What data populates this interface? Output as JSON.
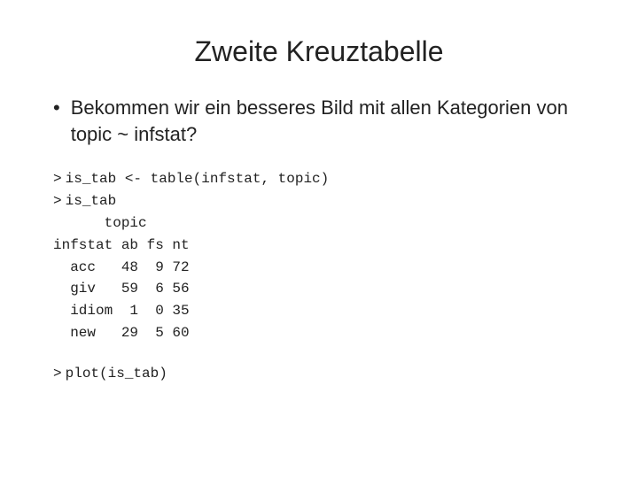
{
  "title": "Zweite Kreuztabelle",
  "bullet": {
    "text": "Bekommen wir ein besseres Bild mit allen Kategorien von topic ~ infstat?"
  },
  "code": {
    "line1_prompt": ">",
    "line1_code": "is_tab <- table(infstat, topic)",
    "line2_prompt": ">",
    "line2_code": "is_tab",
    "table": "      topic\ninfstat ab fs nt\n  acc   48  9 72\n  giv   59  6 56\n  idiom  1  0 35\n  new   29  5 60"
  },
  "plot": {
    "prompt": ">",
    "code": "plot(is_tab)"
  }
}
